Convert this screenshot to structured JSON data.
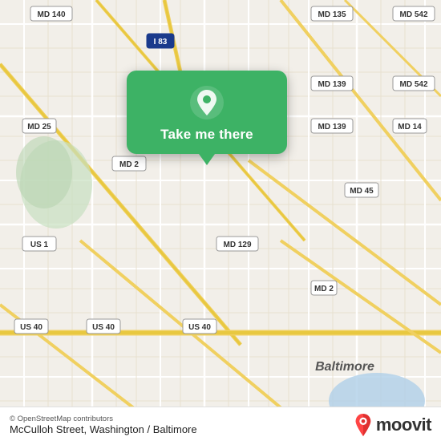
{
  "map": {
    "alt": "OpenStreetMap of Baltimore area"
  },
  "popup": {
    "button_label": "Take me there",
    "pin_icon": "map-pin"
  },
  "bottom_bar": {
    "credit": "© OpenStreetMap contributors",
    "location": "McCulloh Street, Washington / Baltimore",
    "brand": "moovit"
  },
  "colors": {
    "popup_bg": "#3db265",
    "pin_white": "#ffffff",
    "text_dark": "#222222",
    "text_muted": "#555555"
  }
}
